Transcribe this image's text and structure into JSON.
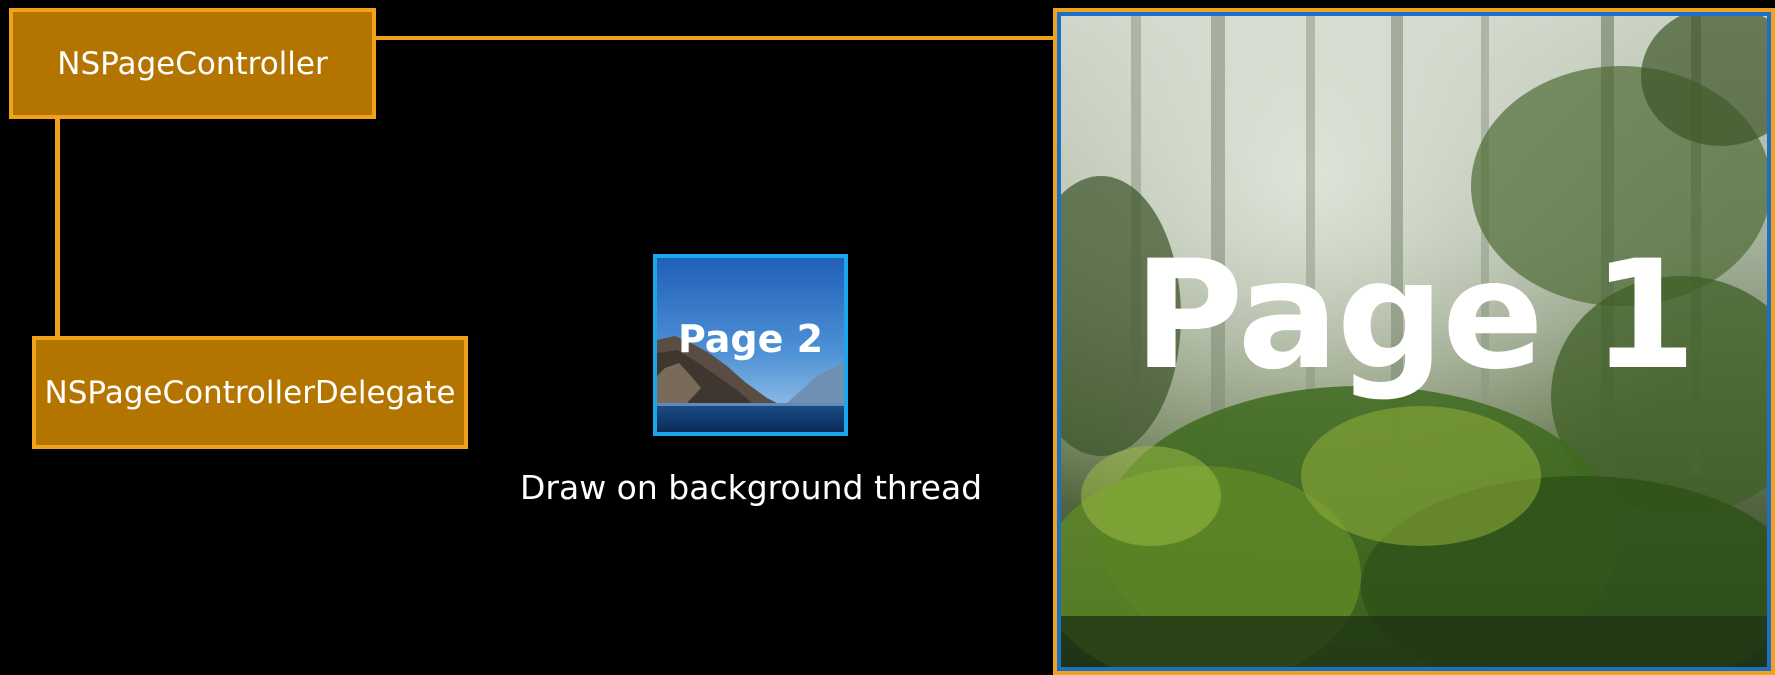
{
  "nodes": {
    "controller": {
      "label": "NSPageController"
    },
    "delegate": {
      "label": "NSPageControllerDelegate"
    }
  },
  "pages": {
    "page1": {
      "label": "Page 1",
      "scene": "misty forest"
    },
    "page2": {
      "label": "Page 2",
      "scene": "mountain lake"
    }
  },
  "caption": "Draw on background thread",
  "colors": {
    "box_fill": "#b47500",
    "box_border": "#f0a21c",
    "connector": "#f0a21c",
    "page1_inner_border": "#1c6fc9",
    "page2_border": "#1ba7ee",
    "background": "#000000"
  }
}
